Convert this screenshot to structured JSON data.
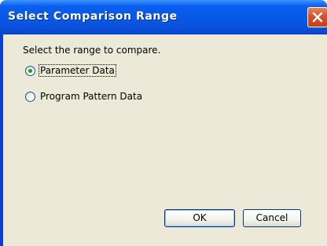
{
  "window": {
    "title": "Select Comparison Range"
  },
  "dialog": {
    "prompt": "Select the range to compare.",
    "options": [
      {
        "label": "Parameter Data",
        "selected": true
      },
      {
        "label": "Program Pattern Data",
        "selected": false
      }
    ]
  },
  "buttons": {
    "ok_label": "OK",
    "cancel_label": "Cancel"
  },
  "icons": {
    "close": "close-icon"
  },
  "colors": {
    "titlebar": "#0a5ef0",
    "close_button": "#d5532c",
    "dialog_background": "#ece9d8",
    "radio_dot": "#21a121"
  }
}
